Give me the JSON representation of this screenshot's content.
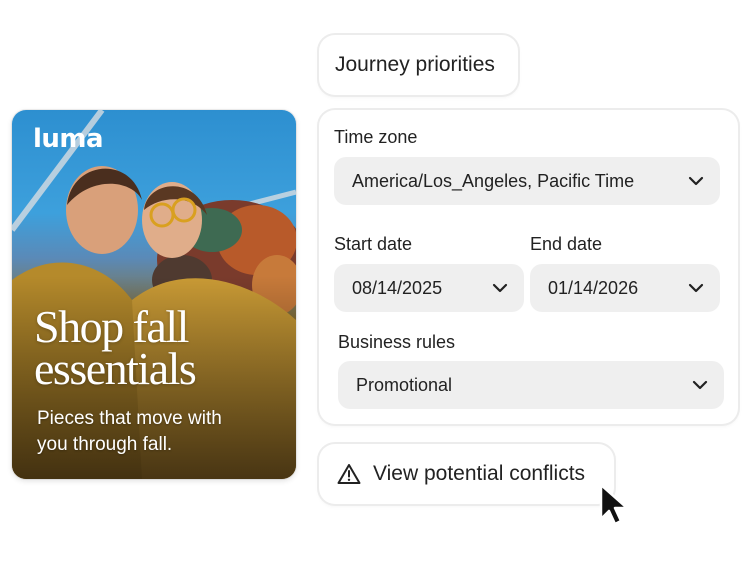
{
  "promo": {
    "logo": "luma",
    "title_line1": "Shop fall",
    "title_line2": "essentials",
    "subtitle_line1": "Pieces that move with",
    "subtitle_line2": "you through fall.",
    "image_icon": "fashion-photo"
  },
  "panel": {
    "heading": "Journey priorities",
    "time_zone": {
      "label": "Time zone",
      "value": "America/Los_Angeles, Pacific Time"
    },
    "start_date": {
      "label": "Start date",
      "value": "08/14/2025"
    },
    "end_date": {
      "label": "End date",
      "value": "01/14/2026"
    },
    "business_rules": {
      "label": "Business rules",
      "value": "Promotional"
    },
    "conflicts_button": {
      "label": "View potential conflicts",
      "icon": "warning-icon"
    }
  },
  "colors": {
    "field_bg": "#efefef",
    "border": "#ececec",
    "text": "#222222"
  }
}
